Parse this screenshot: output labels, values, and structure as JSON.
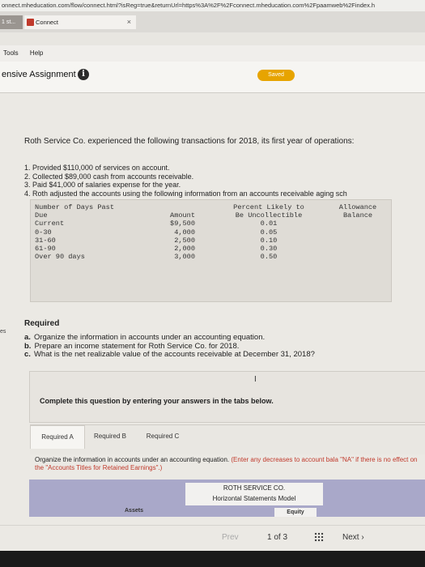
{
  "browser": {
    "url": "onnect.mheducation.com/flow/connect.html?isReg=true&returnUrl=https%3A%2F%2Fconnect.mheducation.com%2Fpaamweb%2Findex.h",
    "tab_left": "1 st...",
    "tab_active": "Connect",
    "tab_close": "×"
  },
  "menu": {
    "tools": "Tools",
    "help": "Help"
  },
  "header": {
    "title": "ensive Assignment",
    "info_icon": "i",
    "status": "Saved"
  },
  "problem": {
    "intro": "Roth Service Co. experienced the following transactions for 2018, its first year of operations:",
    "steps": [
      "1. Provided $110,000 of services on account.",
      "2. Collected $89,000 cash from accounts receivable.",
      "3. Paid $41,000 of salaries expense for the year.",
      "4. Roth adjusted the accounts using the following information from an accounts receivable aging sch"
    ]
  },
  "aging_table": {
    "headers": {
      "days_past_due": [
        "Number of Days Past",
        "Due"
      ],
      "amount": [
        "",
        "Amount"
      ],
      "percent": [
        "Percent Likely to",
        "Be Uncollectible"
      ],
      "allowance": [
        "Allowance",
        "Balance"
      ]
    },
    "rows": [
      {
        "days": "Current",
        "amount": "$9,500",
        "percent": "0.01"
      },
      {
        "days": "0-30",
        "amount": "4,000",
        "percent": "0.05"
      },
      {
        "days": "31-60",
        "amount": "2,500",
        "percent": "0.10"
      },
      {
        "days": "61-90",
        "amount": "2,000",
        "percent": "0.30"
      },
      {
        "days": "Over 90 days",
        "amount": "3,000",
        "percent": "0.50"
      }
    ]
  },
  "required": {
    "label": "Required",
    "side_fragment": "es",
    "items": [
      {
        "letter": "a.",
        "text": "Organize the information in accounts under an accounting equation."
      },
      {
        "letter": "b.",
        "text": "Prepare an income statement for Roth Service Co. for 2018."
      },
      {
        "letter": "c.",
        "text": "What is the net realizable value of the accounts receivable at December 31, 2018?"
      }
    ]
  },
  "panel": {
    "text": "Complete this question by entering your answers in the tabs below."
  },
  "tabs": [
    "Required A",
    "Required B",
    "Required C"
  ],
  "instructions": {
    "text": "Organize the information in accounts under an accounting equation.",
    "note": "(Enter any decreases to account bala \"NA\" if there is no effect on the \"Accounts Titles for Retained Earnings\".)"
  },
  "model": {
    "company": "ROTH SERVICE CO.",
    "title": "Horizontal Statements Model",
    "assets": "Assets",
    "equity": "Equity"
  },
  "pager": {
    "prev": "Prev",
    "page": "1",
    "of": "of",
    "total": "3",
    "next": "Next"
  },
  "colors": {
    "saved": "#e7a400",
    "model_band": "#a9a8c9",
    "note": "#c0392b"
  }
}
